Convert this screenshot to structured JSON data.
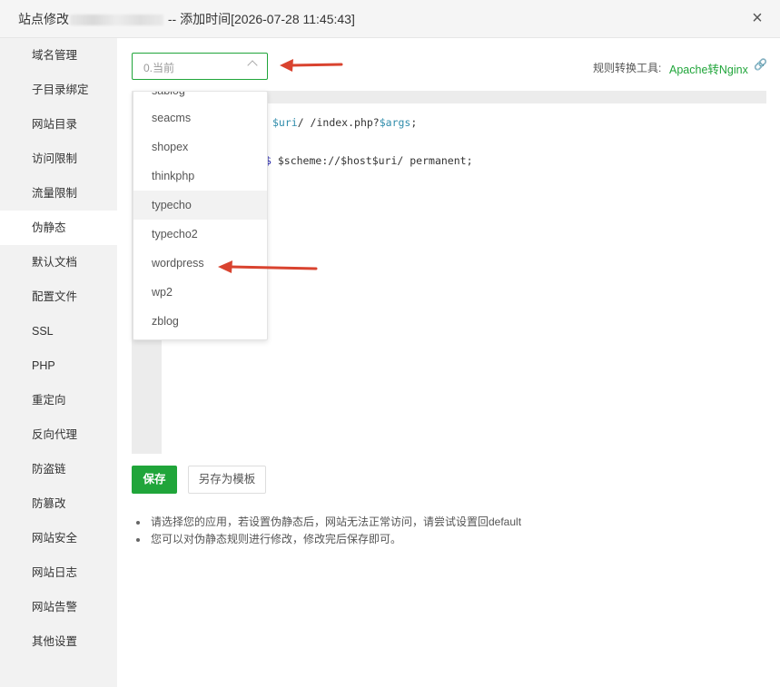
{
  "dialog": {
    "title_prefix": "站点修改",
    "title_suffix": "-- 添加时间[2026-07-28 11:45:43]",
    "close_label": "×"
  },
  "sidebar": {
    "items": [
      {
        "label": "域名管理"
      },
      {
        "label": "子目录绑定"
      },
      {
        "label": "网站目录"
      },
      {
        "label": "访问限制"
      },
      {
        "label": "流量限制"
      },
      {
        "label": "伪静态"
      },
      {
        "label": "默认文档"
      },
      {
        "label": "配置文件"
      },
      {
        "label": "SSL"
      },
      {
        "label": "PHP"
      },
      {
        "label": "重定向"
      },
      {
        "label": "反向代理"
      },
      {
        "label": "防盗链"
      },
      {
        "label": "防篡改"
      },
      {
        "label": "网站安全"
      },
      {
        "label": "网站日志"
      },
      {
        "label": "网站告警"
      },
      {
        "label": "其他设置"
      }
    ],
    "active": "伪静态"
  },
  "rewrite": {
    "select_value": "0.当前",
    "tool_label": "规则转换工具:",
    "tool_link": "Apache转Nginx",
    "dropdown_partial": "sablog",
    "dropdown_options": [
      {
        "label": "seacms"
      },
      {
        "label": "shopex"
      },
      {
        "label": "thinkphp"
      },
      {
        "label": "typecho"
      },
      {
        "label": "typecho2"
      },
      {
        "label": "wordpress"
      },
      {
        "label": "wp2"
      },
      {
        "label": "zblog"
      }
    ],
    "hovered_option": "typecho",
    "code": {
      "line1_var1": "$uri",
      "line1_mid": "/ /index.php?",
      "line1_var2": "$args",
      "line1_end": ";",
      "line2_dollar": "$",
      "line2_rest": " $scheme://$host$uri/ permanent;"
    },
    "save_label": "保存",
    "save_template_label": "另存为模板"
  },
  "tips": [
    "请选择您的应用，若设置伪静态后，网站无法正常访问，请尝试设置回default",
    "您可以对伪静态规则进行修改，修改完后保存即可。"
  ],
  "colors": {
    "accent": "#20a53a",
    "annotation_arrow": "#d9432f"
  }
}
